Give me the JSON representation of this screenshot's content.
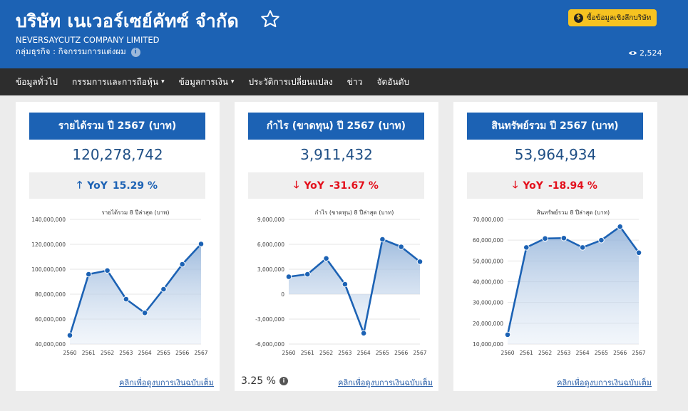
{
  "header": {
    "title": "บริษัท เนเวอร์เซย์คัทซ์ จำกัด",
    "subtitle_en": "NEVERSAYCUTZ COMPANY LIMITED",
    "business_group": "กลุ่มธุรกิจ : กิจกรรมการแต่งผม",
    "buy_button": "ซื้อข้อมูลเชิงลึกบริษัท",
    "views": "2,524",
    "colors": {
      "header_bg": "#1c62b4",
      "button": "#f7c320"
    }
  },
  "nav": [
    {
      "label": "ข้อมูลทั่วไป"
    },
    {
      "label": "กรรมการและการถือหุ้น"
    },
    {
      "label": "ข้อมูลการเงิน"
    },
    {
      "label": "ประวัติการเปลี่ยนแปลง"
    },
    {
      "label": "ข่าว"
    },
    {
      "label": "จัดอันดับ"
    }
  ],
  "cards": [
    {
      "heading": "รายได้รวม ปี 2567 (บาท)",
      "value": "120,278,742",
      "yoy_label": "YoY",
      "yoy_value": "15.29 %",
      "yoy_direction": "up",
      "link": "คลิกเพื่อดูงบการเงินฉบับเต็ม"
    },
    {
      "heading": "กำไร (ขาดทุน) ปี 2567 (บาท)",
      "value": "3,911,432",
      "yoy_label": "YoY",
      "yoy_value": "-31.67 %",
      "yoy_direction": "down",
      "ratio": "3.25 %",
      "link": "คลิกเพื่อดูงบการเงินฉบับเต็ม"
    },
    {
      "heading": "สินทรัพย์รวม ปี 2567 (บาท)",
      "value": "53,964,934",
      "yoy_label": "YoY",
      "yoy_value": "-18.94 %",
      "yoy_direction": "down",
      "link": "คลิกเพื่อดูงบการเงินฉบับเต็ม"
    }
  ],
  "chart_data": [
    {
      "type": "area",
      "title": "รายได้รวม 8 ปีล่าสุด (บาท)",
      "x": [
        "2560",
        "2561",
        "2562",
        "2563",
        "2564",
        "2565",
        "2566",
        "2567"
      ],
      "values": [
        47000000,
        96000000,
        99000000,
        76000000,
        65000000,
        84000000,
        104000000,
        120278742
      ],
      "ylim": [
        40000000,
        140000000
      ],
      "yticks": [
        40000000,
        60000000,
        80000000,
        100000000,
        120000000,
        140000000
      ],
      "ytick_labels": [
        "40,000,000",
        "60,000,000",
        "80,000,000",
        "100,000,000",
        "120,000,000",
        "140,000,000"
      ],
      "color": "#1c62b4"
    },
    {
      "type": "area",
      "title": "กำไร (ขาดทุน) 8 ปีล่าสุด (บาท)",
      "x": [
        "2560",
        "2561",
        "2562",
        "2563",
        "2564",
        "2565",
        "2566",
        "2567"
      ],
      "values": [
        2100000,
        2400000,
        4300000,
        1200000,
        -4700000,
        6600000,
        5700000,
        3911432
      ],
      "ylim": [
        -6000000,
        9000000
      ],
      "yticks": [
        -6000000,
        -3000000,
        0,
        3000000,
        6000000,
        9000000
      ],
      "ytick_labels": [
        "-6,000,000",
        "-3,000,000",
        "0",
        "3,000,000",
        "6,000,000",
        "9,000,000"
      ],
      "color": "#1c62b4"
    },
    {
      "type": "area",
      "title": "สินทรัพย์รวม 8 ปีล่าสุด (บาท)",
      "x": [
        "2560",
        "2561",
        "2562",
        "2563",
        "2564",
        "2565",
        "2566",
        "2567"
      ],
      "values": [
        14500000,
        56500000,
        60800000,
        61000000,
        56500000,
        60000000,
        66500000,
        53964934
      ],
      "ylim": [
        10000000,
        70000000
      ],
      "yticks": [
        10000000,
        20000000,
        30000000,
        40000000,
        50000000,
        60000000,
        70000000
      ],
      "ytick_labels": [
        "10,000,000",
        "20,000,000",
        "30,000,000",
        "40,000,000",
        "50,000,000",
        "60,000,000",
        "70,000,000"
      ],
      "color": "#1c62b4"
    }
  ]
}
